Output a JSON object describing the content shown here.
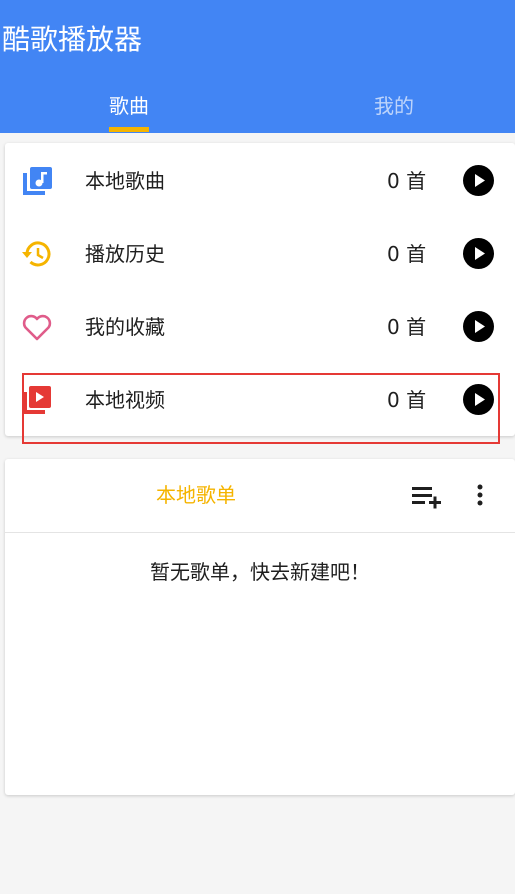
{
  "app": {
    "title": "酷歌播放器"
  },
  "tabs": [
    {
      "label": "歌曲",
      "active": true
    },
    {
      "label": "我的",
      "active": false
    }
  ],
  "colors": {
    "primary": "#4285f4",
    "accent": "#f5b400",
    "highlight_border": "#e53935",
    "favorite_icon": "#e05c8a",
    "history_icon": "#f5b400",
    "video_icon": "#e53935",
    "music_icon": "#4285f4"
  },
  "library": {
    "items": [
      {
        "label": "本地歌曲",
        "count": "0 首",
        "icon": "music-library-icon"
      },
      {
        "label": "播放历史",
        "count": "0 首",
        "icon": "history-icon"
      },
      {
        "label": "我的收藏",
        "count": "0 首",
        "icon": "heart-icon"
      },
      {
        "label": "本地视频",
        "count": "0 首",
        "icon": "video-icon"
      }
    ]
  },
  "playlist": {
    "title": "本地歌单",
    "empty_message": "暂无歌单，快去新建吧！",
    "add_icon": "playlist-add-icon",
    "more_icon": "more-vertical-icon"
  }
}
